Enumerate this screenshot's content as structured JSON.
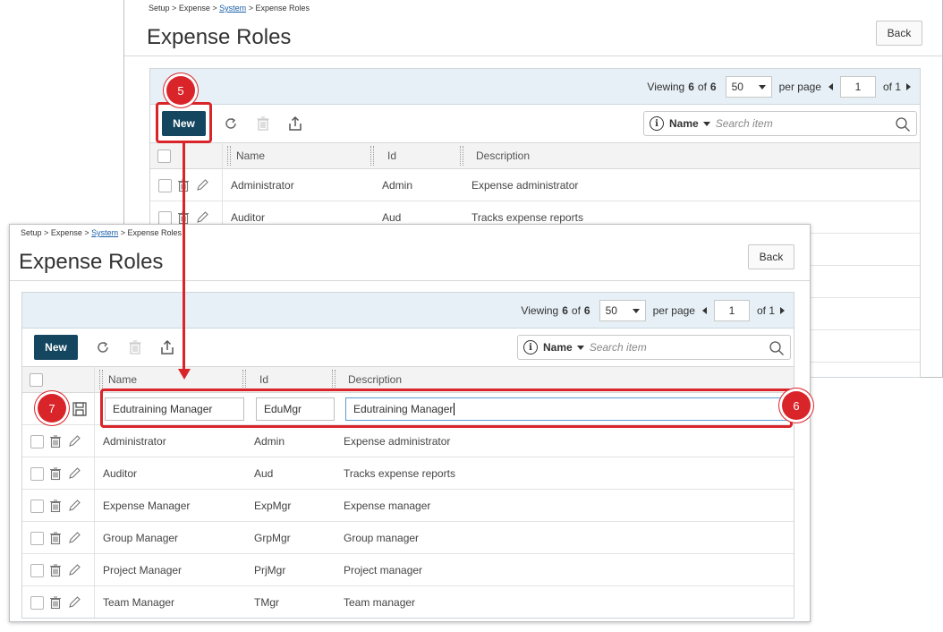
{
  "breadcrumb": {
    "setup": "Setup",
    "expense": "Expense",
    "system": "System",
    "current": "Expense Roles",
    "sep": ">"
  },
  "page": {
    "title": "Expense Roles",
    "back_label": "Back"
  },
  "pager": {
    "viewing_label": "Viewing",
    "count": "6",
    "of_label": "of",
    "total": "6",
    "per_page_value": "50",
    "per_page_label": "per page",
    "page_value": "1",
    "of_pages_label": "of 1"
  },
  "toolbar": {
    "new_label": "New"
  },
  "search": {
    "info": "i",
    "field": "Name",
    "placeholder": "Search item"
  },
  "columns": {
    "name": "Name",
    "id": "Id",
    "description": "Description"
  },
  "back_rows": [
    {
      "name": "Administrator",
      "id": "Admin",
      "description": "Expense administrator"
    },
    {
      "name": "Auditor",
      "id": "Aud",
      "description": "Tracks expense reports"
    }
  ],
  "new_row": {
    "name": "Edutraining Manager",
    "id": "EduMgr",
    "description": "Edutraining Manager"
  },
  "rows": [
    {
      "name": "Administrator",
      "id": "Admin",
      "description": "Expense administrator"
    },
    {
      "name": "Auditor",
      "id": "Aud",
      "description": "Tracks expense reports"
    },
    {
      "name": "Expense Manager",
      "id": "ExpMgr",
      "description": "Expense manager"
    },
    {
      "name": "Group Manager",
      "id": "GrpMgr",
      "description": "Group manager"
    },
    {
      "name": "Project Manager",
      "id": "PrjMgr",
      "description": "Project manager"
    },
    {
      "name": "Team Manager",
      "id": "TMgr",
      "description": "Team manager"
    }
  ],
  "callouts": {
    "step5": "5",
    "step6": "6",
    "step7": "7"
  },
  "colors": {
    "primary": "#14465f",
    "callout": "#d9252a",
    "pager_bg": "#e6f0f6",
    "link": "#1a5fa8"
  }
}
